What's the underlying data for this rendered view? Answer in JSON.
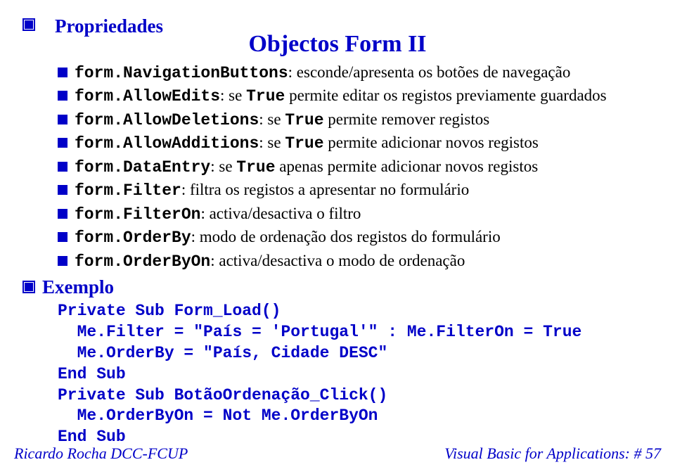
{
  "title": "Objectos Form II",
  "sections": {
    "propriedades": "Propriedades",
    "exemplo": "Exemplo"
  },
  "props": [
    {
      "code": "form.NavigationButtons",
      "desc": ": esconde/apresenta os botões de navegação"
    },
    {
      "code": "form.AllowEdits",
      "desc_prefix": ": se ",
      "kw": "True",
      "desc_suffix": " permite editar os registos previamente guardados"
    },
    {
      "code": "form.AllowDeletions",
      "desc_prefix": ": se ",
      "kw": "True",
      "desc_suffix": " permite remover registos"
    },
    {
      "code": "form.AllowAdditions",
      "desc_prefix": ": se ",
      "kw": "True",
      "desc_suffix": " permite adicionar novos registos"
    },
    {
      "code": "form.DataEntry",
      "desc_prefix": ": se ",
      "kw": "True",
      "desc_suffix": " apenas permite adicionar novos registos"
    },
    {
      "code": "form.Filter",
      "desc": ": filtra os registos a apresentar no formulário"
    },
    {
      "code": "form.FilterOn",
      "desc": ": activa/desactiva o filtro"
    },
    {
      "code": "form.OrderBy",
      "desc": ": modo de ordenação dos registos do formulário"
    },
    {
      "code": "form.OrderByOn",
      "desc": ": activa/desactiva o modo de ordenação"
    }
  ],
  "code": "Private Sub Form_Load()\n  Me.Filter = \"País = 'Portugal'\" : Me.FilterOn = True\n  Me.OrderBy = \"País, Cidade DESC\"\nEnd Sub\nPrivate Sub BotãoOrdenação_Click()\n  Me.OrderByOn = Not Me.OrderByOn\nEnd Sub",
  "footer": {
    "left": "Ricardo Rocha DCC-FCUP",
    "right": "Visual Basic for Applications: # 57"
  }
}
